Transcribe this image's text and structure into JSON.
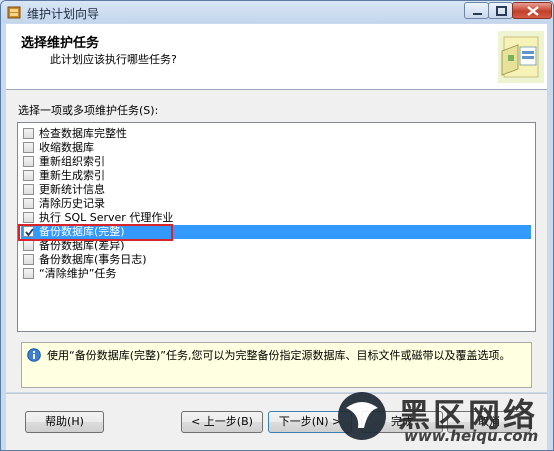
{
  "window": {
    "title": "维护计划向导"
  },
  "header": {
    "title": "选择维护任务",
    "subtitle": "此计划应该执行哪些任务?"
  },
  "list": {
    "label": "选择一项或多项维护任务(S):",
    "items": [
      {
        "label": "检查数据库完整性",
        "checked": false
      },
      {
        "label": "收缩数据库",
        "checked": false
      },
      {
        "label": "重新组织索引",
        "checked": false
      },
      {
        "label": "重新生成索引",
        "checked": false
      },
      {
        "label": "更新统计信息",
        "checked": false
      },
      {
        "label": "清除历史记录",
        "checked": false
      },
      {
        "label": "执行 SQL Server 代理作业",
        "checked": false
      },
      {
        "label": "备份数据库(完整)",
        "checked": true,
        "selected": true
      },
      {
        "label": "备份数据库(差异)",
        "checked": false
      },
      {
        "label": "备份数据库(事务日志)",
        "checked": false
      },
      {
        "label": "“清除维护”任务",
        "checked": false
      }
    ]
  },
  "description": {
    "text": "使用“备份数据库(完整)”任务,您可以为完整备份指定源数据库、目标文件或磁带以及覆盖选项。"
  },
  "buttons": {
    "help": "帮助(H)",
    "back": "< 上一步(B)",
    "next": "下一步(N) >",
    "finish": "完成",
    "cancel": "取消"
  },
  "watermark": {
    "text": "黑区网络",
    "url": "www.heiqu.com"
  },
  "colors": {
    "selection": "#3399ff",
    "highlight_box": "#d8232a",
    "info_bg": "#ffffe1"
  }
}
